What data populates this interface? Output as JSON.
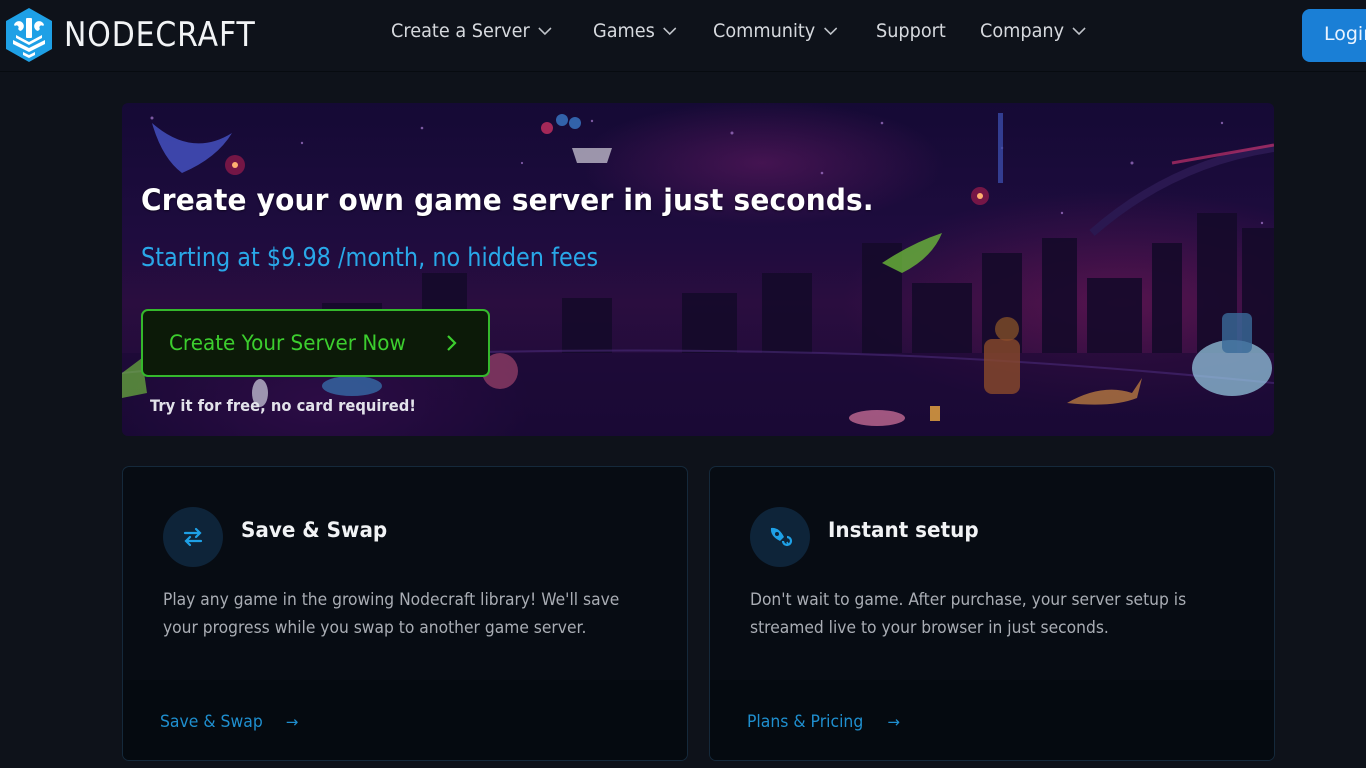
{
  "brand": {
    "name": "NODECRAFT",
    "accent_color": "#1ea0e6"
  },
  "nav": {
    "items": [
      {
        "label": "Create a Server",
        "has_dropdown": true,
        "icon": "chevron-down-icon"
      },
      {
        "label": "Games",
        "has_dropdown": true,
        "icon": "chevron-down-icon"
      },
      {
        "label": "Community",
        "has_dropdown": true,
        "icon": "chevron-down-icon"
      },
      {
        "label": "Support",
        "has_dropdown": false
      },
      {
        "label": "Company",
        "has_dropdown": true,
        "icon": "chevron-down-icon"
      }
    ],
    "login_label": "Login",
    "login_color": "#1a7fd6"
  },
  "hero": {
    "title": "Create your own game server in just seconds.",
    "subtitle": "Starting at $9.98 /month, no hidden fees",
    "cta_label": "Create Your Server Now",
    "cta_icon": "chevron-right-icon",
    "cta_color": "#3cce2e",
    "note": "Try it for free, no card required!"
  },
  "features": [
    {
      "icon": "swap-arrows-icon",
      "title": "Save & Swap",
      "description": "Play any game in the growing Nodecraft library! We'll save your progress while you swap to another game server.",
      "link_label": "Save & Swap",
      "link_icon": "arrow-right-icon",
      "link_arrow": "→"
    },
    {
      "icon": "rocket-icon",
      "title": "Instant setup",
      "description": "Don't wait to game. After purchase, your server setup is streamed live to your browser in just seconds.",
      "link_label": "Plans & Pricing",
      "link_icon": "arrow-right-icon",
      "link_arrow": "→"
    }
  ]
}
